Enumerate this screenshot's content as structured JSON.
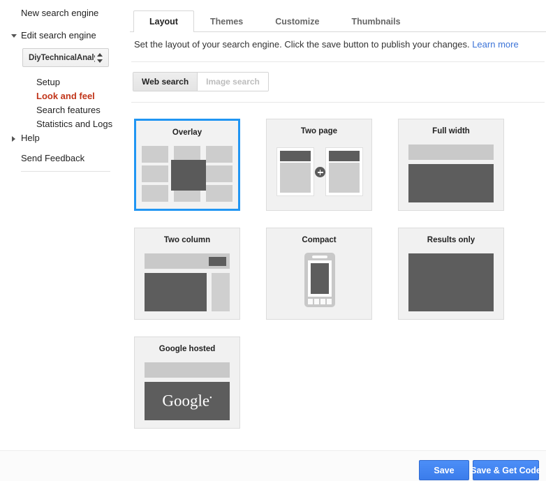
{
  "sidebar": {
    "new_search_engine": "New search engine",
    "edit_search_engine": "Edit search engine",
    "engine_name": "DiyTechnicalAnalys",
    "sub_items": [
      {
        "label": "Setup",
        "active": false
      },
      {
        "label": "Look and feel",
        "active": true
      },
      {
        "label": "Search features",
        "active": false
      },
      {
        "label": "Statistics and Logs",
        "active": false
      }
    ],
    "help": "Help",
    "send_feedback": "Send Feedback",
    "active_color": "#c1351a"
  },
  "main": {
    "tabs": [
      {
        "label": "Layout",
        "active": true
      },
      {
        "label": "Themes",
        "active": false
      },
      {
        "label": "Customize",
        "active": false
      },
      {
        "label": "Thumbnails",
        "active": false
      }
    ],
    "description": "Set the layout of your search engine. Click the save button to publish your changes.",
    "learn_more": "Learn more",
    "learn_more_color": "#3b73d8",
    "segments": [
      {
        "label": "Web search",
        "selected": true,
        "disabled": false
      },
      {
        "label": "Image search",
        "selected": false,
        "disabled": true
      }
    ],
    "layouts": [
      {
        "title": "Overlay",
        "art": "overlay",
        "selected": true
      },
      {
        "title": "Two page",
        "art": "twopage",
        "selected": false
      },
      {
        "title": "Full width",
        "art": "fullwidth",
        "selected": false
      },
      {
        "title": "Two column",
        "art": "twocolumn",
        "selected": false
      },
      {
        "title": "Compact",
        "art": "compact",
        "selected": false
      },
      {
        "title": "Results only",
        "art": "resultsonly",
        "selected": false
      },
      {
        "title": "Google hosted",
        "art": "googlehosted",
        "selected": false
      }
    ],
    "google_wordmark": "Google",
    "selection_color": "#2196f3"
  },
  "footer": {
    "save_label": "Save",
    "save_get_code_label": "Save & Get Code",
    "button_color": "#3b7ceb"
  }
}
